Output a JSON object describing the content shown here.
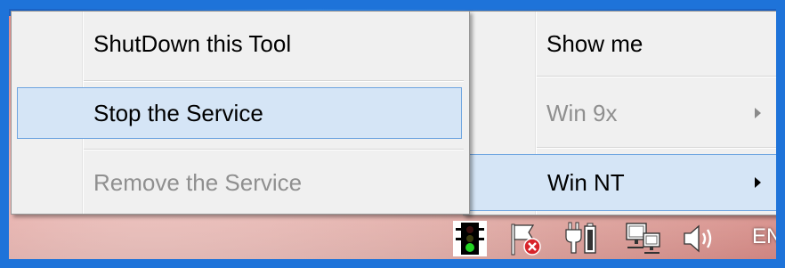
{
  "main_menu": {
    "items": [
      {
        "label": "ShutDown this Tool",
        "state": "normal"
      },
      {
        "label": "Stop the Service",
        "state": "hover"
      },
      {
        "label": "Remove the Service",
        "state": "disabled"
      }
    ]
  },
  "sub_menu": {
    "items": [
      {
        "label": "Show me",
        "state": "normal",
        "has_submenu": false
      },
      {
        "label": "Win 9x",
        "state": "disabled",
        "has_submenu": true
      },
      {
        "label": "Win NT",
        "state": "selected",
        "has_submenu": true
      }
    ]
  },
  "tray": {
    "icons": [
      "traffic-light-icon",
      "action-center-flag-error-icon",
      "power-battery-icon",
      "network-icon",
      "volume-icon"
    ],
    "language": "EN"
  },
  "colors": {
    "highlight_fill": "#d5e5f6",
    "highlight_border": "#6fa5e0",
    "menu_bg": "#f0f0f0",
    "frame_blue": "#1e73d9"
  }
}
